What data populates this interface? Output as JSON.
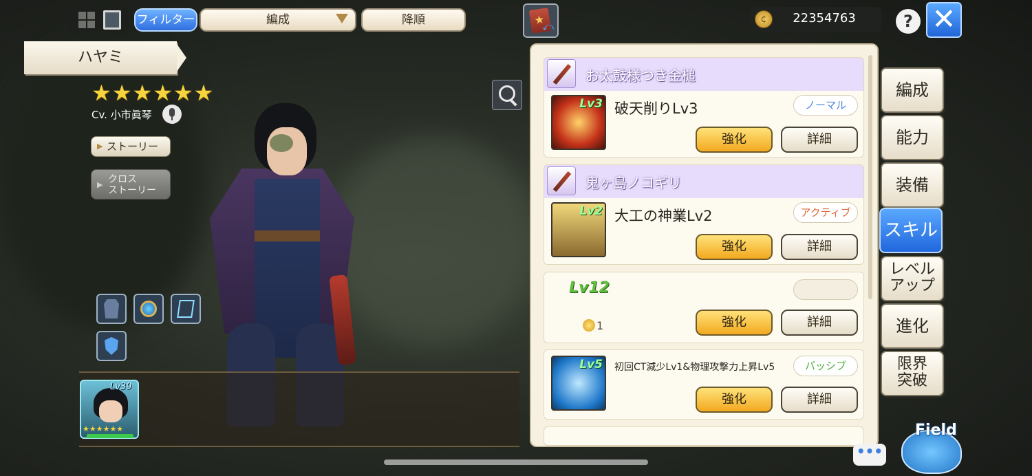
{
  "topbar": {
    "filter_label": "フィルター",
    "sort_label": "編成",
    "order_label": "降順",
    "coins": "22354763",
    "help_label": "?",
    "close_label": "✕"
  },
  "character": {
    "name": "ハヤミ",
    "stars": "★★★★★★",
    "cv": "Cv. 小市眞琴",
    "story_label": "ストーリー",
    "cross_story_line1": "クロス",
    "cross_story_line2": "ストーリー"
  },
  "party": {
    "level": "Lv39",
    "stars": "★★★★★★"
  },
  "skills": {
    "weapon1_name": "お太鼓様つき金槌",
    "skill1_level": "Lv3",
    "skill1_name": "破天削りLv3",
    "skill1_tag": "ノーマル",
    "weapon2_name": "鬼ヶ島ノコギリ",
    "skill2_level": "Lv2",
    "skill2_name": "大工の神業Lv2",
    "skill2_tag": "アクティブ",
    "locked_level": "Lv12",
    "locked_cost": "1",
    "skill3_level": "Lv5",
    "skill3_name": "初回CT減少Lv1&物理攻撃力上昇Lv5",
    "skill3_tag": "パッシブ",
    "upgrade_label": "強化",
    "detail_label": "詳細"
  },
  "tabs": {
    "formation": "編成",
    "ability": "能力",
    "equipment": "装備",
    "skill": "スキル",
    "levelup_line1": "レベル",
    "levelup_line2": "アップ",
    "evolution": "進化",
    "limit_line1": "限界",
    "limit_line2": "突破"
  },
  "bottom": {
    "chat": "•••",
    "field": "Field"
  },
  "colors": {
    "accent_blue": "#2f6fe0",
    "upgrade_gold": "#f2a91f",
    "passive_green": "#4fae3a",
    "active_orange": "#e0683f",
    "normal_blue": "#4d87d6"
  }
}
